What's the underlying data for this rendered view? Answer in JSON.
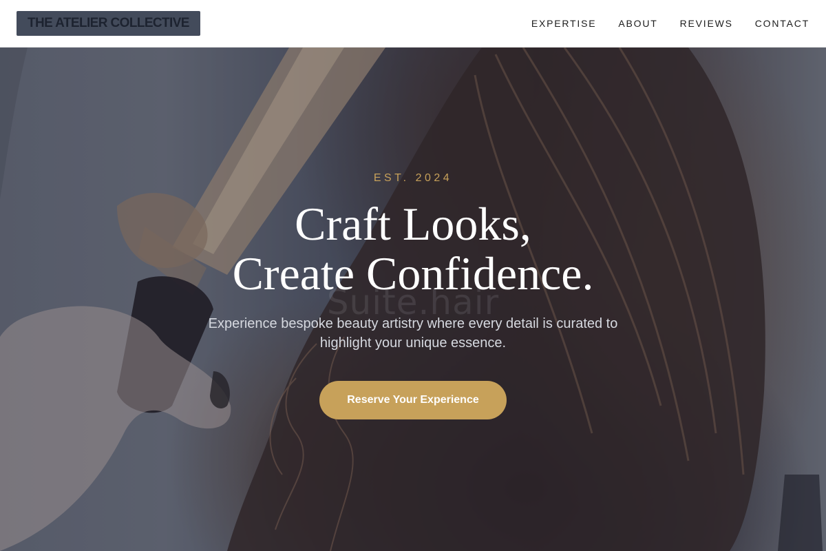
{
  "header": {
    "logo_text": "THE ATELIER COLLECTIVE",
    "nav": [
      {
        "label": "EXPERTISE"
      },
      {
        "label": "ABOUT"
      },
      {
        "label": "REVIEWS"
      },
      {
        "label": "CONTACT"
      }
    ]
  },
  "hero": {
    "eyebrow": "EST. 2024",
    "title_line_1": "Craft Looks,",
    "title_line_2": "Create Confidence.",
    "watermark": "Suite.hair",
    "subtitle": "Experience bespoke beauty artistry where every detail is curated to highlight your unique essence.",
    "cta_label": "Reserve Your Experience",
    "background_image": "hairstylist-curling-iron-brown-hair"
  },
  "colors": {
    "accent_gold": "#c7a15a",
    "logo_bg": "#434b5b",
    "logo_text": "#1d2330",
    "nav_text": "#1c1c1c",
    "hero_title": "#ffffff",
    "hero_subtitle": "#d6d9e0"
  }
}
